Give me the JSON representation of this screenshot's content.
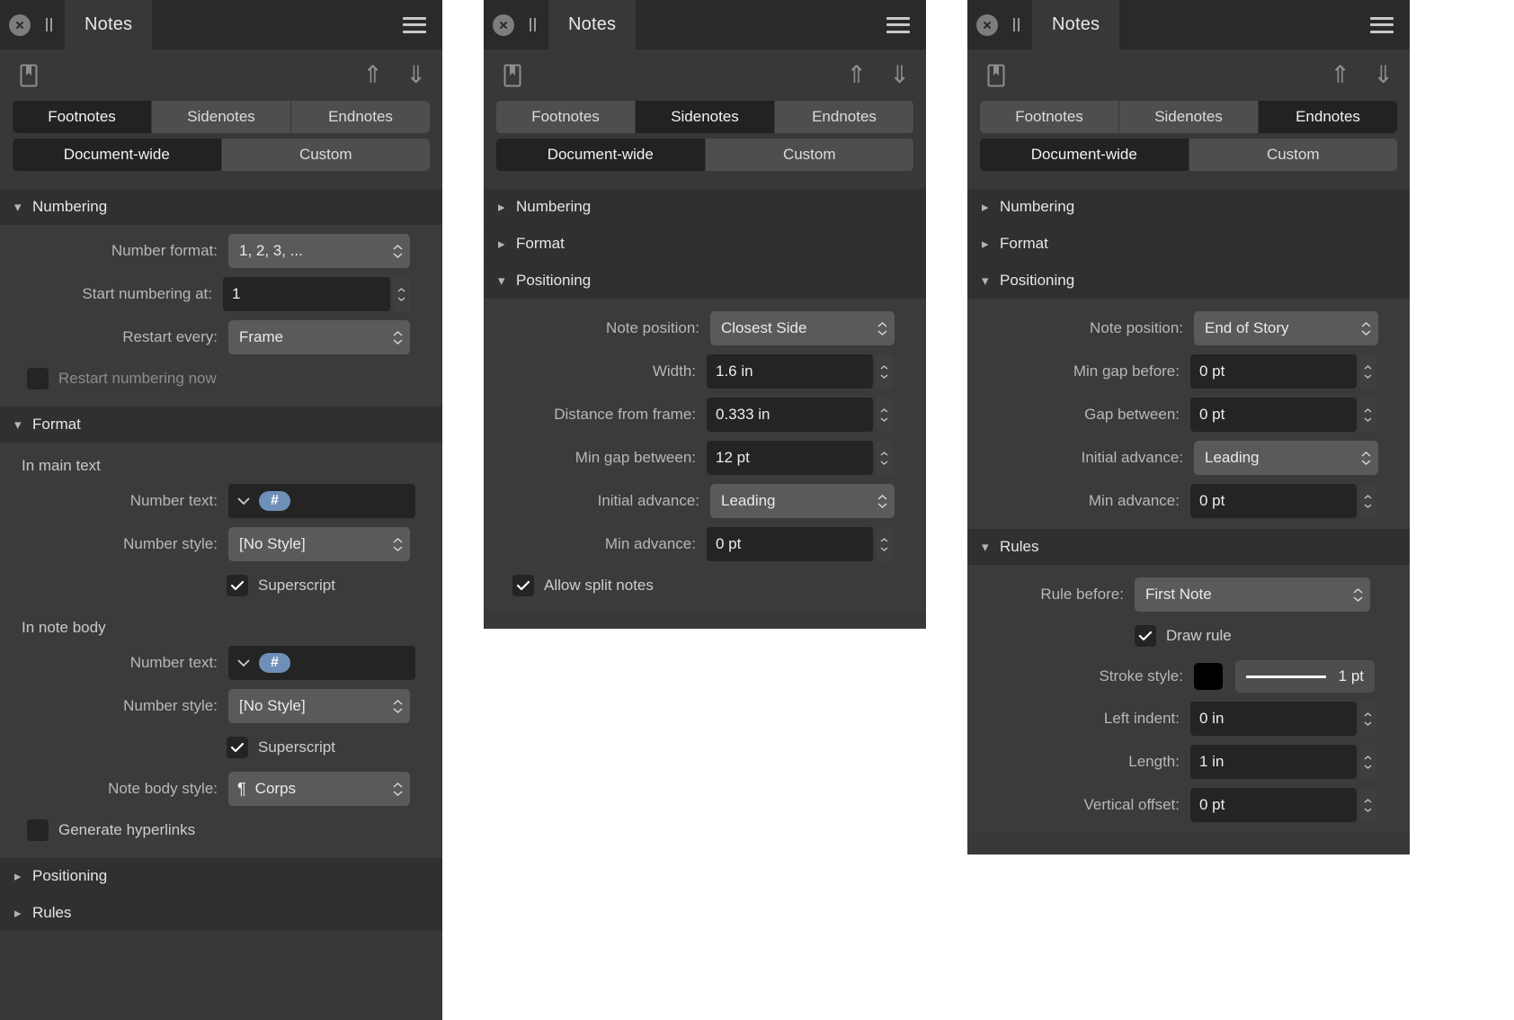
{
  "panels": [
    {
      "id": "footnotes-panel",
      "titlebar": {
        "tab_label": "Notes",
        "close_icon": "close-icon",
        "grip_icon": "drag-grip-icon",
        "menu_icon": "hamburger-menu-icon"
      },
      "toolbar": {
        "bookmark_icon": "bookmark-icon",
        "up_icon": "arrow-up-icon",
        "down_icon": "arrow-down-icon",
        "up_glyph": "⇑",
        "down_glyph": "⇓"
      },
      "note_types": [
        "Footnotes",
        "Sidenotes",
        "Endnotes"
      ],
      "note_type_active": "Footnotes",
      "scopes": [
        "Document-wide",
        "Custom"
      ],
      "scope_active": "Document-wide",
      "sections": {
        "numbering": {
          "title": "Numbering",
          "expanded": true,
          "number_format": {
            "label": "Number format:",
            "value": "1, 2, 3, ..."
          },
          "start_numbering_at": {
            "label": "Start numbering at:",
            "value": "1"
          },
          "restart_every": {
            "label": "Restart every:",
            "value": "Frame"
          },
          "restart_now": {
            "label": "Restart numbering now",
            "checked": false,
            "disabled": true
          }
        },
        "format": {
          "title": "Format",
          "expanded": true,
          "in_main_text": {
            "subhead": "In main text",
            "number_text": {
              "label": "Number text:",
              "token": "#"
            },
            "number_style": {
              "label": "Number style:",
              "value": "[No Style]"
            },
            "superscript": {
              "label": "Superscript",
              "checked": true
            }
          },
          "in_note_body": {
            "subhead": "In note body",
            "number_text": {
              "label": "Number text:",
              "token": "#"
            },
            "number_style": {
              "label": "Number style:",
              "value": "[No Style]"
            },
            "superscript": {
              "label": "Superscript",
              "checked": true
            },
            "note_body_style": {
              "label": "Note body style:",
              "value": "Corps",
              "icon": "pilcrow-icon"
            }
          },
          "generate_hyperlinks": {
            "label": "Generate hyperlinks",
            "checked": false
          }
        },
        "positioning": {
          "title": "Positioning",
          "expanded": false
        },
        "rules": {
          "title": "Rules",
          "expanded": false
        }
      }
    },
    {
      "id": "sidenotes-panel",
      "titlebar": {
        "tab_label": "Notes",
        "close_icon": "close-icon",
        "grip_icon": "drag-grip-icon",
        "menu_icon": "hamburger-menu-icon"
      },
      "toolbar": {
        "bookmark_icon": "bookmark-icon",
        "up_icon": "arrow-up-icon",
        "down_icon": "arrow-down-icon",
        "up_glyph": "⇑",
        "down_glyph": "⇓"
      },
      "note_types": [
        "Footnotes",
        "Sidenotes",
        "Endnotes"
      ],
      "note_type_active": "Sidenotes",
      "scopes": [
        "Document-wide",
        "Custom"
      ],
      "scope_active": "Document-wide",
      "sections": {
        "numbering": {
          "title": "Numbering",
          "expanded": false
        },
        "format": {
          "title": "Format",
          "expanded": false
        },
        "positioning": {
          "title": "Positioning",
          "expanded": true,
          "note_position": {
            "label": "Note position:",
            "value": "Closest Side"
          },
          "width": {
            "label": "Width:",
            "value": "1.6 in"
          },
          "distance_from_frame": {
            "label": "Distance from frame:",
            "value": "0.333 in"
          },
          "min_gap_between": {
            "label": "Min gap between:",
            "value": "12 pt"
          },
          "initial_advance": {
            "label": "Initial advance:",
            "value": "Leading"
          },
          "min_advance": {
            "label": "Min advance:",
            "value": "0 pt"
          },
          "allow_split_notes": {
            "label": "Allow split notes",
            "checked": true
          }
        }
      }
    },
    {
      "id": "endnotes-panel",
      "titlebar": {
        "tab_label": "Notes",
        "close_icon": "close-icon",
        "grip_icon": "drag-grip-icon",
        "menu_icon": "hamburger-menu-icon"
      },
      "toolbar": {
        "bookmark_icon": "bookmark-icon",
        "up_icon": "arrow-up-icon",
        "down_icon": "arrow-down-icon",
        "up_glyph": "⇑",
        "down_glyph": "⇓"
      },
      "note_types": [
        "Footnotes",
        "Sidenotes",
        "Endnotes"
      ],
      "note_type_active": "Endnotes",
      "scopes": [
        "Document-wide",
        "Custom"
      ],
      "scope_active": "Document-wide",
      "sections": {
        "numbering": {
          "title": "Numbering",
          "expanded": false
        },
        "format": {
          "title": "Format",
          "expanded": false
        },
        "positioning": {
          "title": "Positioning",
          "expanded": true,
          "note_position": {
            "label": "Note position:",
            "value": "End of Story"
          },
          "min_gap_before": {
            "label": "Min gap before:",
            "value": "0 pt"
          },
          "gap_between": {
            "label": "Gap between:",
            "value": "0 pt"
          },
          "initial_advance": {
            "label": "Initial advance:",
            "value": "Leading"
          },
          "min_advance": {
            "label": "Min advance:",
            "value": "0 pt"
          }
        },
        "rules": {
          "title": "Rules",
          "expanded": true,
          "rule_before": {
            "label": "Rule before:",
            "value": "First Note"
          },
          "draw_rule": {
            "label": "Draw rule",
            "checked": true
          },
          "stroke_style": {
            "label": "Stroke style:",
            "color": "#000000",
            "width_value": "1 pt"
          },
          "left_indent": {
            "label": "Left indent:",
            "value": "0 in"
          },
          "length": {
            "label": "Length:",
            "value": "1 in"
          },
          "vertical_offset": {
            "label": "Vertical offset:",
            "value": "0 pt"
          }
        }
      }
    }
  ],
  "colors": {
    "panel_bg": "#383838",
    "section_header_bg": "#303030",
    "section_body_bg": "#3b3b3b",
    "titlebar_bg": "#2a2a2a",
    "popup_bg": "#5a5a5a",
    "text_field_bg": "#242424",
    "active_segment_bg": "#222222",
    "inactive_segment_bg": "#4e4e4e",
    "token_blue": "#6d8fb8",
    "label_text": "#b7b7b7",
    "value_text": "#ededed"
  }
}
